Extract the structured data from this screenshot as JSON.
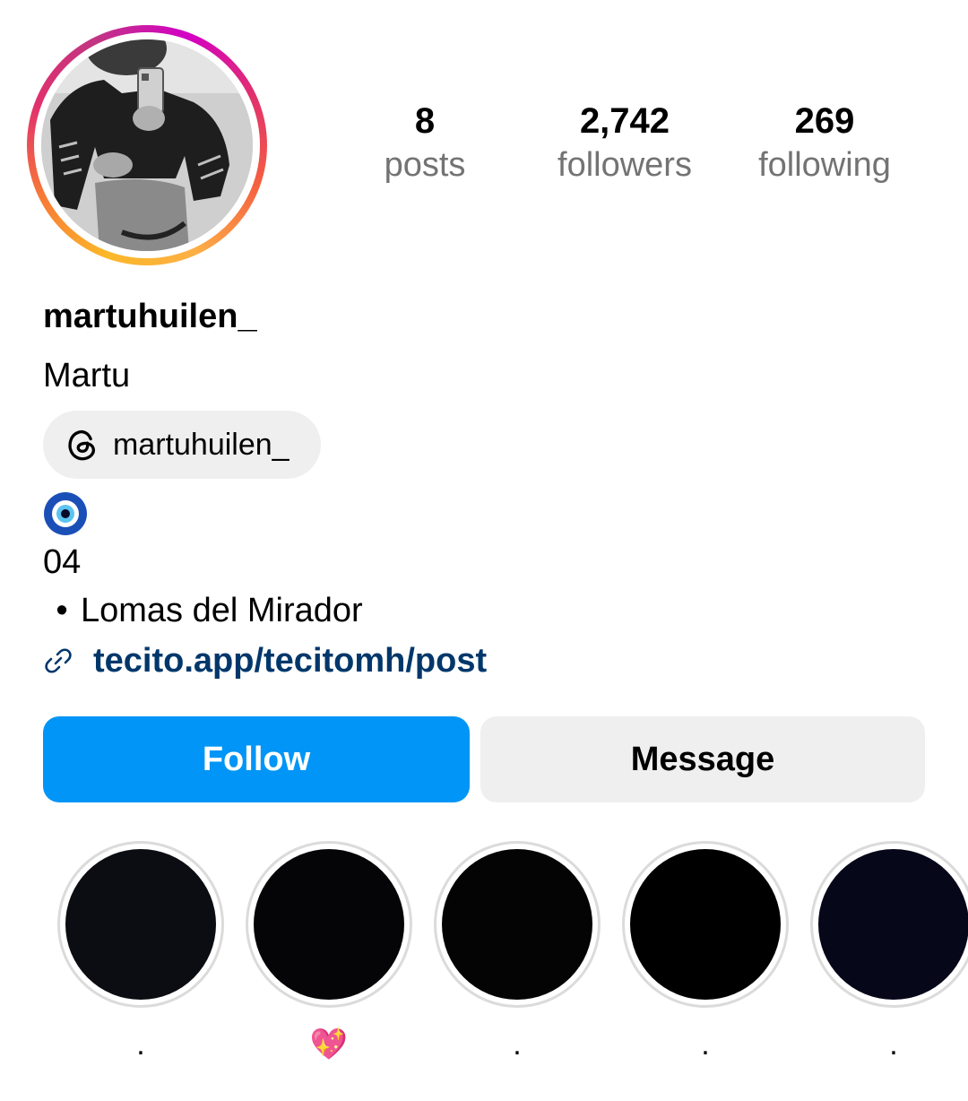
{
  "profile": {
    "username": "martuhuilen_",
    "full_name": "Martu",
    "avatar_icon": "profile-photo"
  },
  "stats": {
    "posts": {
      "value": "8",
      "label": "posts"
    },
    "followers": {
      "value": "2,742",
      "label": "followers"
    },
    "following": {
      "value": "269",
      "label": "following"
    }
  },
  "threads": {
    "handle": "martuhuilen_",
    "icon": "threads-icon"
  },
  "bio": {
    "emoji": "🧿",
    "line1": "04",
    "bullet": "•",
    "line2": "Lomas del Mirador"
  },
  "link": {
    "icon": "link-icon",
    "url": "tecito.app/tecitomh/post"
  },
  "buttons": {
    "follow": "Follow",
    "message": "Message"
  },
  "highlights": [
    {
      "caption": ".",
      "cover_color": "#0b0d12"
    },
    {
      "caption": "💖",
      "cover_color": "#050507"
    },
    {
      "caption": ".",
      "cover_color": "#040405"
    },
    {
      "caption": ".",
      "cover_color": "#000000"
    },
    {
      "caption": ".",
      "cover_color": "#07071a"
    }
  ],
  "colors": {
    "follow_button": "#0095f6",
    "message_button": "#efefef",
    "link_text": "#00376b",
    "secondary_text": "#737373"
  }
}
